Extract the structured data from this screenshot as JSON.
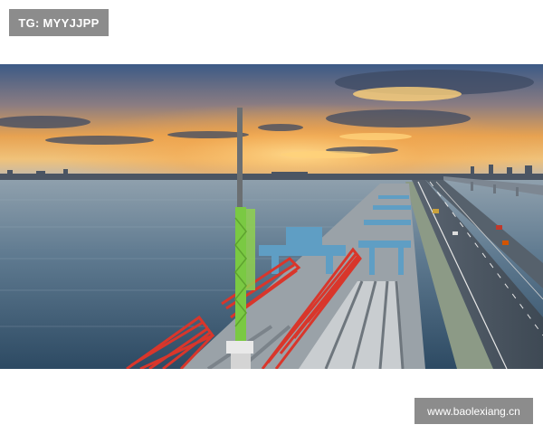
{
  "watermark_top": "TG: MYYJJPP",
  "watermark_bottom": "www.baolexiang.cn",
  "photo": {
    "subject": "sea-crossing-bridge-construction-at-sunset"
  },
  "colors": {
    "crane_green": "#7ac943",
    "girder_red": "#d9362b",
    "sky_orange": "#f2a12e",
    "sea_blue": "#3a5d7c",
    "watermark_bg": "#8c8c8c"
  }
}
